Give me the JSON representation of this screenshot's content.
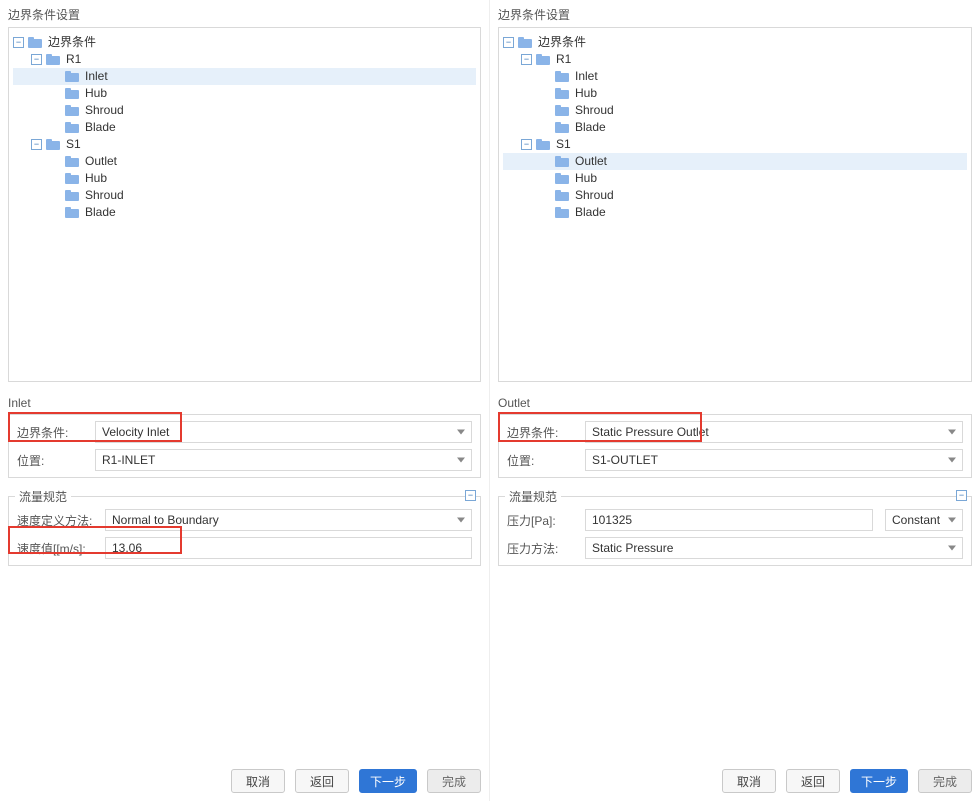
{
  "left": {
    "title": "边界条件设置",
    "tree": {
      "root": "边界条件",
      "groups": [
        {
          "name": "R1",
          "items": [
            "Inlet",
            "Hub",
            "Shroud",
            "Blade"
          ],
          "selected": "Inlet"
        },
        {
          "name": "S1",
          "items": [
            "Outlet",
            "Hub",
            "Shroud",
            "Blade"
          ],
          "selected": null
        }
      ]
    },
    "section_label": "Inlet",
    "bc": {
      "label": "边界条件:",
      "value": "Velocity Inlet",
      "loc_label": "位置:",
      "loc_value": "R1-INLET"
    },
    "flow": {
      "legend": "流量规范",
      "method_label": "速度定义方法:",
      "method_value": "Normal to Boundary",
      "value_label": "速度值[[m/s]:",
      "value_value": "13.06"
    },
    "buttons": {
      "cancel": "取消",
      "back": "返回",
      "next": "下一步",
      "finish": "完成"
    }
  },
  "right": {
    "title": "边界条件设置",
    "tree": {
      "root": "边界条件",
      "groups": [
        {
          "name": "R1",
          "items": [
            "Inlet",
            "Hub",
            "Shroud",
            "Blade"
          ],
          "selected": null
        },
        {
          "name": "S1",
          "items": [
            "Outlet",
            "Hub",
            "Shroud",
            "Blade"
          ],
          "selected": "Outlet"
        }
      ]
    },
    "section_label": "Outlet",
    "bc": {
      "label": "边界条件:",
      "value": "Static Pressure Outlet",
      "loc_label": "位置:",
      "loc_value": "S1-OUTLET"
    },
    "flow": {
      "legend": "流量规范",
      "p_label": "压力[Pa]:",
      "p_value": "101325",
      "p_unit": "Constant",
      "m_label": "压力方法:",
      "m_value": "Static Pressure"
    },
    "buttons": {
      "cancel": "取消",
      "back": "返回",
      "next": "下一步",
      "finish": "完成"
    }
  },
  "toggle_minus": "−"
}
